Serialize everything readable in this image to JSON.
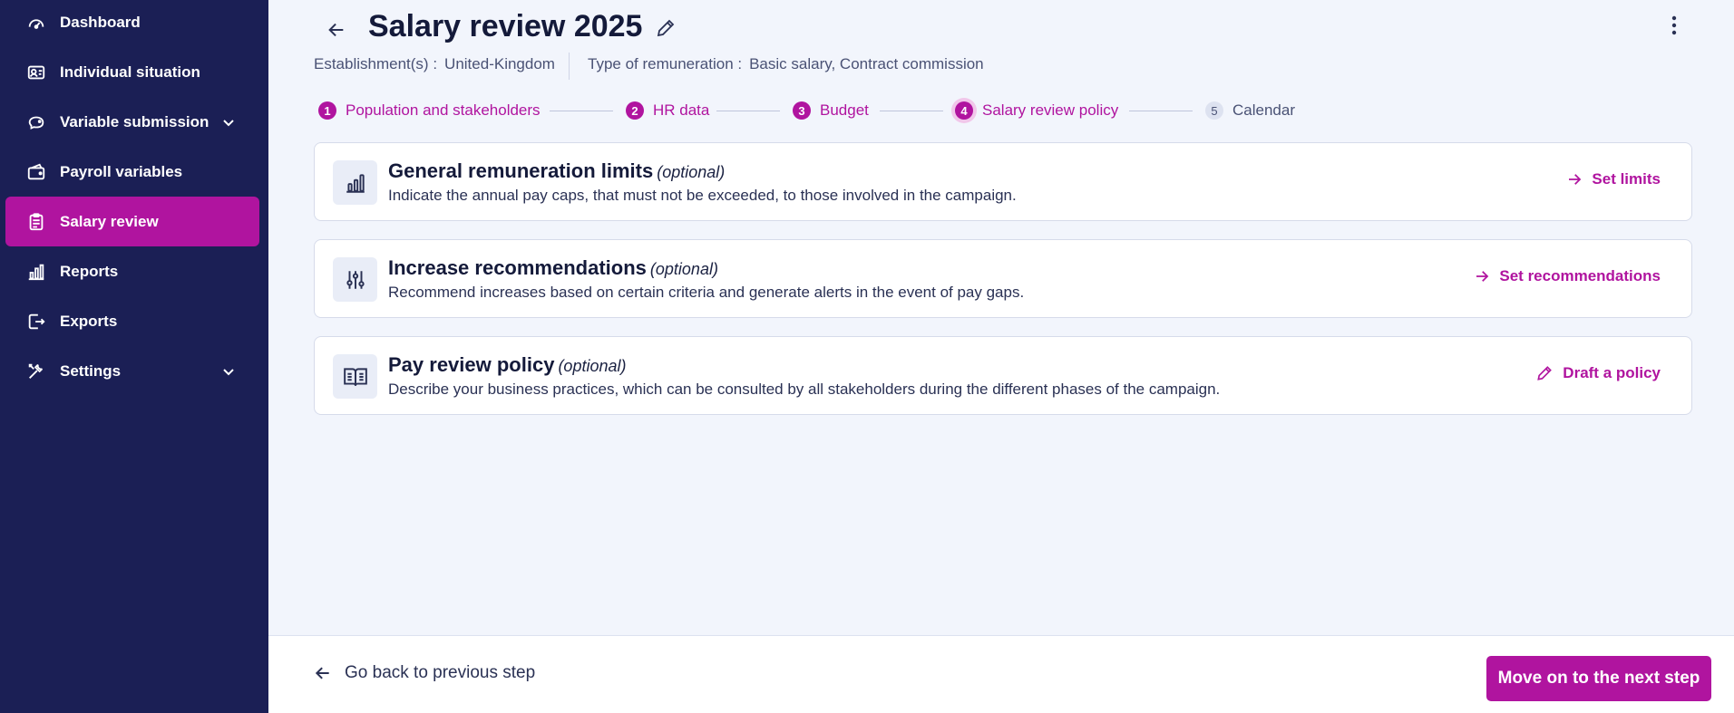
{
  "sidebar": {
    "items": [
      {
        "label": "Dashboard",
        "icon": "gauge-icon"
      },
      {
        "label": "Individual situation",
        "icon": "user-card-icon"
      },
      {
        "label": "Variable submission",
        "icon": "piggy-bank-icon",
        "expandable": true
      },
      {
        "label": "Payroll variables",
        "icon": "wallet-icon"
      },
      {
        "label": "Salary review",
        "icon": "clipboard-icon",
        "active": true
      },
      {
        "label": "Reports",
        "icon": "bar-chart-icon"
      },
      {
        "label": "Exports",
        "icon": "export-icon"
      },
      {
        "label": "Settings",
        "icon": "tools-icon",
        "expandable": true
      }
    ]
  },
  "header": {
    "title": "Salary review 2025",
    "establishment_label": "Establishment(s) :",
    "establishment_value": "United-Kingdom",
    "remuneration_label": "Type of remuneration :",
    "remuneration_value": "Basic salary, Contract commission"
  },
  "stepper": {
    "steps": [
      {
        "number": "1",
        "label": "Population and stakeholders",
        "state": "done"
      },
      {
        "number": "2",
        "label": "HR data",
        "state": "done"
      },
      {
        "number": "3",
        "label": "Budget",
        "state": "done"
      },
      {
        "number": "4",
        "label": "Salary review policy",
        "state": "current"
      },
      {
        "number": "5",
        "label": "Calendar",
        "state": "upcoming"
      }
    ]
  },
  "cards": [
    {
      "title": "General remuneration limits",
      "optional": "(optional)",
      "description": "Indicate the annual pay caps, that must not be exceeded, to those involved in the campaign.",
      "action": "Set limits",
      "icon": "bar-chart-icon"
    },
    {
      "title": "Increase recommendations",
      "optional": "(optional)",
      "description": "Recommend increases based on certain criteria and generate alerts in the event of pay gaps.",
      "action": "Set recommendations",
      "icon": "sliders-icon"
    },
    {
      "title": "Pay review policy",
      "optional": "(optional)",
      "description": "Describe your business practices, which can be consulted by all stakeholders during the different phases of the campaign.",
      "action": "Draft a policy",
      "icon": "open-book-icon"
    }
  ],
  "footer": {
    "back_label": "Go back to previous step",
    "next_label": "Move on to the next step"
  },
  "colors": {
    "sidebar_bg": "#1b1f55",
    "accent": "#b0149f",
    "page_bg": "#f2f5fc"
  }
}
